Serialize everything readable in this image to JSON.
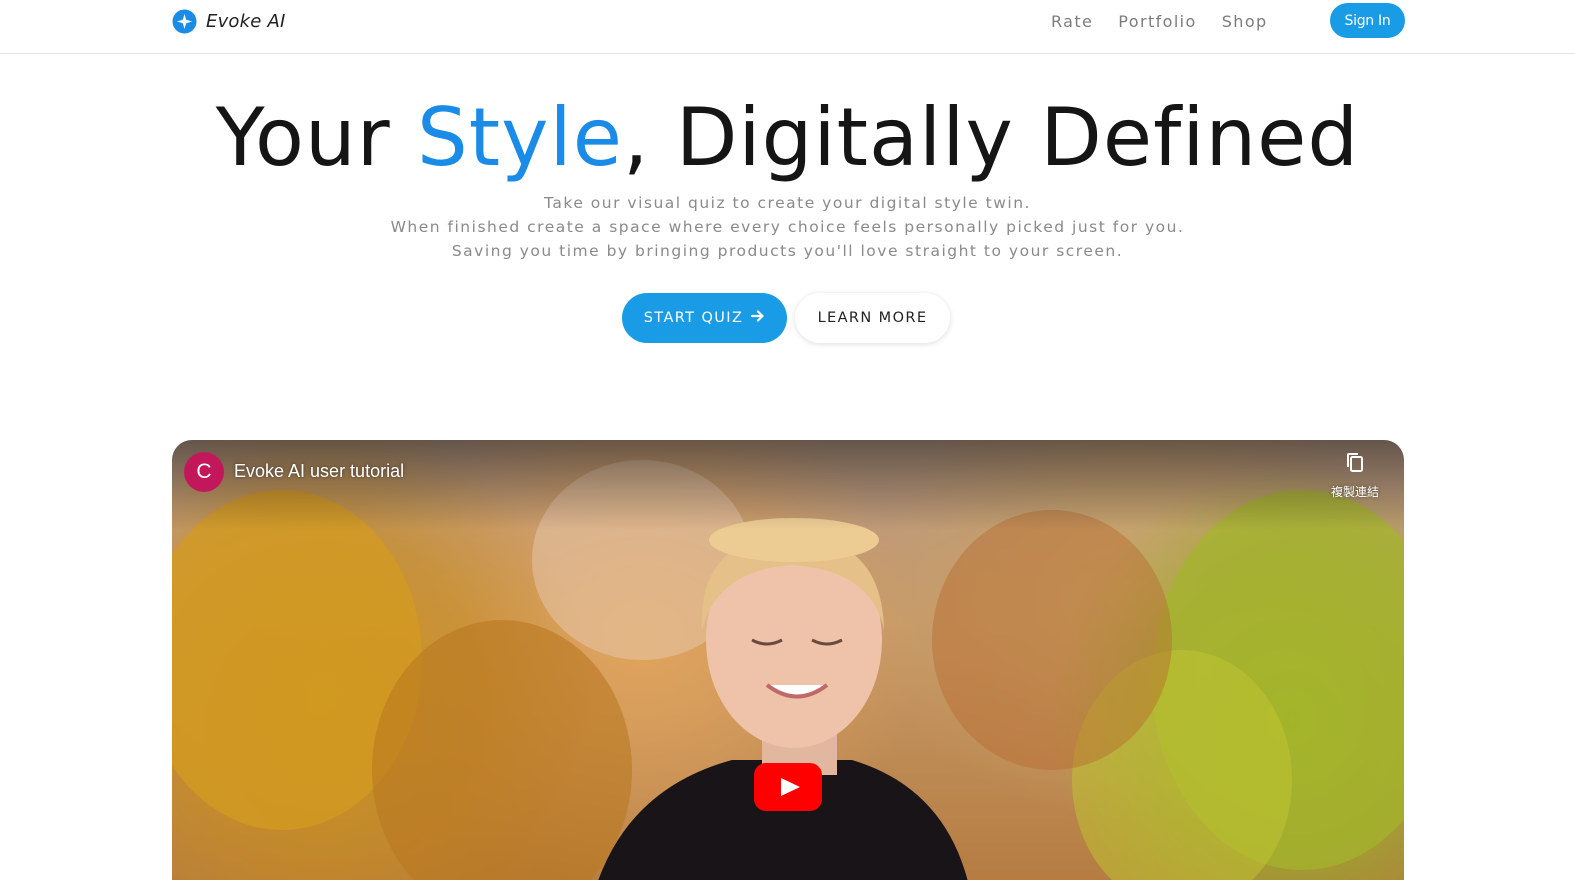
{
  "nav": {
    "brand": "Evoke AI",
    "links": [
      "Rate",
      "Portfolio",
      "Shop"
    ],
    "signin": "Sign In"
  },
  "hero": {
    "title_pre": "Your ",
    "title_accent": "Style",
    "title_post": ", Digitally Defined",
    "sub1": "Take our visual quiz to create your digital style twin.",
    "sub2": "When finished create a space where every choice feels personally picked just for you.",
    "sub3": "Saving you time by bringing products you'll love straight to your screen.",
    "cta_primary": "START QUIZ",
    "cta_secondary": "LEARN MORE"
  },
  "video": {
    "channel_initial": "C",
    "title": "Evoke AI user tutorial",
    "copy_link_label": "複製連結"
  },
  "colors": {
    "accent": "#1a8be6",
    "button": "#1a9be6",
    "avatar": "#c2185b",
    "play": "#ff0000"
  },
  "icons": [
    "sparkle-logo-icon",
    "arrow-right-icon",
    "copy-icon",
    "play-icon"
  ]
}
